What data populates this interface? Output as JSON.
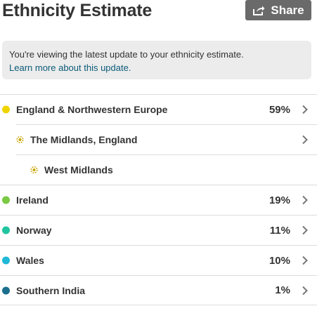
{
  "header": {
    "title": "Ethnicity Estimate",
    "share_label": "Share"
  },
  "notice": {
    "text": "You're viewing the latest update to your ethnicity estimate.",
    "link": "Learn more about this update."
  },
  "regions": [
    {
      "name": "England & Northwestern Europe",
      "percent": "59%",
      "color": "#f0d400"
    },
    {
      "name": "The Midlands, England",
      "color": "#c9a600"
    },
    {
      "name": "West Midlands",
      "color": "#c9a600"
    },
    {
      "name": "Ireland",
      "percent": "19%",
      "color": "#7ac943"
    },
    {
      "name": "Norway",
      "percent": "11%",
      "color": "#1fc4a0"
    },
    {
      "name": "Wales",
      "percent": "10%",
      "color": "#1fb8d6"
    },
    {
      "name": "Southern India",
      "percent": "1%",
      "color": "#1a6f8c"
    }
  ],
  "icons": {
    "share": "share-icon",
    "chevron": "chevron-right-icon"
  }
}
